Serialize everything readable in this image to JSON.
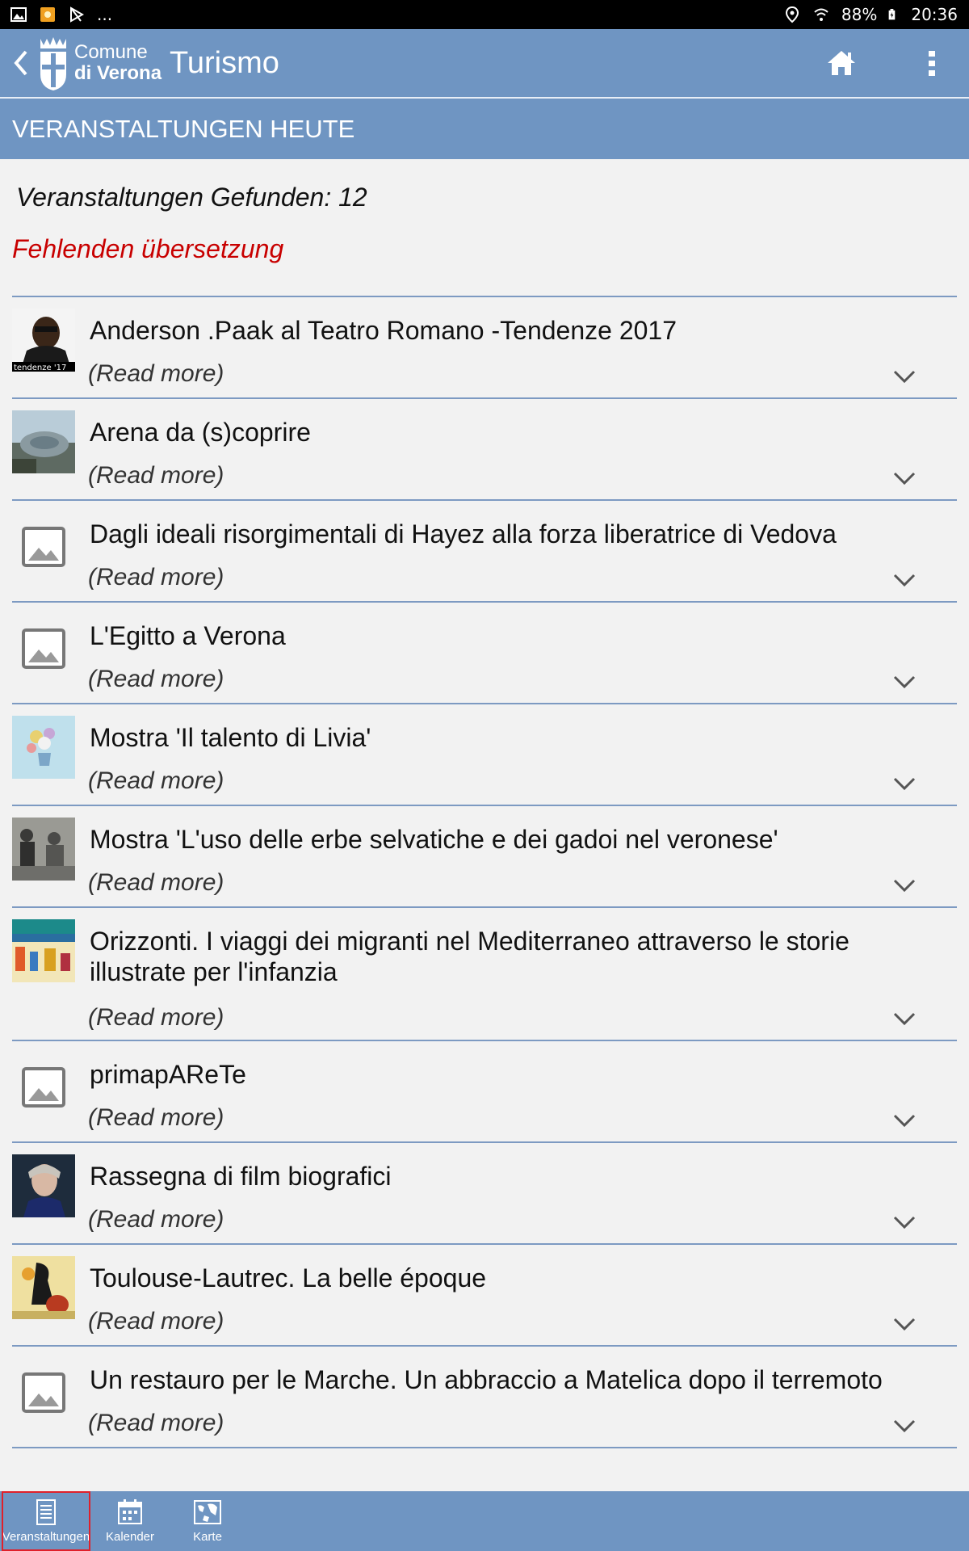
{
  "status_bar": {
    "left_icons": [
      "image-icon",
      "notification-icon",
      "media-icon"
    ],
    "left_more": "...",
    "battery": "88%",
    "time": "20:36",
    "right_icons": [
      "location-icon",
      "wifi-icon",
      "battery-icon"
    ]
  },
  "app_bar": {
    "logo_line1": "Comune",
    "logo_line2": "di Verona",
    "title": "Turismo",
    "home_icon": "home-icon",
    "menu_icon": "more-vert-icon"
  },
  "section": {
    "title": "VERANSTALTUNGEN HEUTE"
  },
  "results": {
    "count_text": "Veranstaltungen Gefunden: 12",
    "warning": "Fehlenden übersetzung"
  },
  "events": [
    {
      "title": "Anderson .Paak al Teatro Romano -Tendenze 2017",
      "read_more": "(Read more)",
      "thumb": "photo-performer",
      "thumb_caption": "tendenze '17"
    },
    {
      "title": "Arena da (s)coprire",
      "read_more": "(Read more)",
      "thumb": "photo-arena"
    },
    {
      "title": "Dagli ideali risorgimentali di Hayez alla forza liberatrice di Vedova",
      "read_more": "(Read more)",
      "thumb": "placeholder"
    },
    {
      "title": "L'Egitto a Verona",
      "read_more": "(Read more)",
      "thumb": "placeholder"
    },
    {
      "title": "Mostra 'Il talento di Livia'",
      "read_more": "(Read more)",
      "thumb": "photo-flowers"
    },
    {
      "title": "Mostra 'L'uso delle erbe selvatiche e dei gadoi nel veronese'",
      "read_more": "(Read more)",
      "thumb": "photo-bw"
    },
    {
      "title": "Orizzonti. I viaggi dei migranti nel Mediterraneo attraverso le storie illustrate per l'infanzia",
      "read_more": "(Read more)",
      "thumb": "photo-poster"
    },
    {
      "title": "primapAReTe",
      "read_more": "(Read more)",
      "thumb": "placeholder"
    },
    {
      "title": "Rassegna di film biografici",
      "read_more": "(Read more)",
      "thumb": "photo-portrait"
    },
    {
      "title": "Toulouse-Lautrec. La belle époque",
      "read_more": "(Read more)",
      "thumb": "photo-lautrec"
    },
    {
      "title": "Un restauro per le Marche. Un abbraccio a Matelica dopo il terremoto",
      "read_more": "(Read more)",
      "thumb": "placeholder"
    }
  ],
  "bottom_nav": [
    {
      "label": "Veranstaltungen",
      "icon": "list-icon",
      "active": true
    },
    {
      "label": "Kalender",
      "icon": "calendar-icon",
      "active": false
    },
    {
      "label": "Karte",
      "icon": "map-icon",
      "active": false
    }
  ],
  "colors": {
    "bar_blue": "#6f95c2",
    "divider": "#7d9ac2",
    "warning_red": "#c80000",
    "background": "#f2f2f2"
  }
}
